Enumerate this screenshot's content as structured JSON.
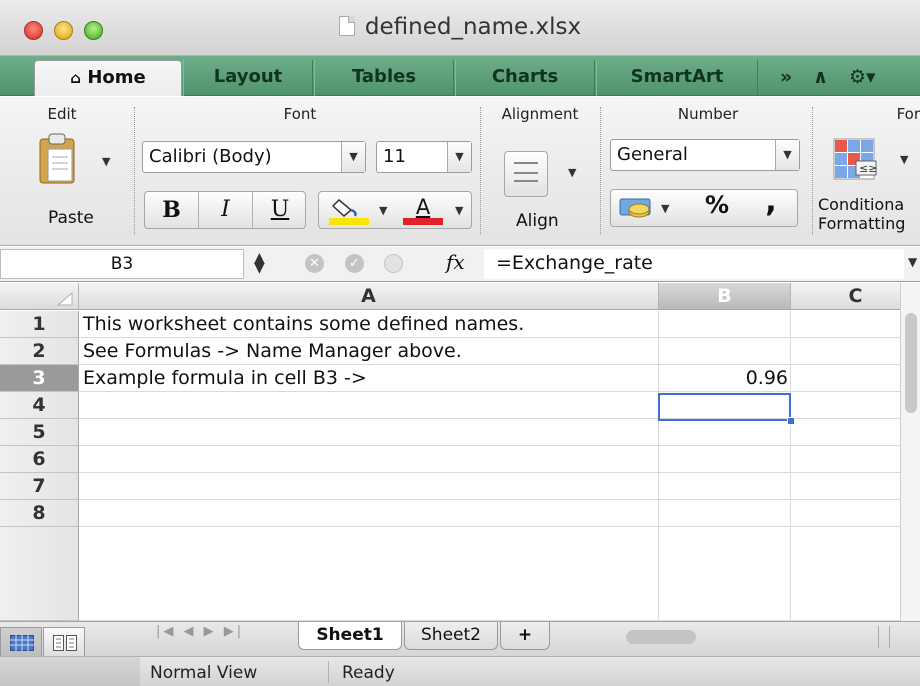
{
  "window": {
    "title": "defined_name.xlsx"
  },
  "tabs": [
    {
      "label": "Home",
      "icon": "house-icon",
      "active": true
    },
    {
      "label": "Layout"
    },
    {
      "label": "Tables"
    },
    {
      "label": "Charts"
    },
    {
      "label": "SmartArt"
    }
  ],
  "tabs_overflow": "»",
  "ribbon": {
    "groups": {
      "edit": "Edit",
      "font": "Font",
      "alignment": "Alignment",
      "number": "Number",
      "format": "For"
    },
    "paste_label": "Paste",
    "font_name": "Calibri (Body)",
    "font_size": "11",
    "bold": "B",
    "italic": "I",
    "underline": "U",
    "font_color_letter": "A",
    "align_label": "Align",
    "number_format": "General",
    "percent": "%",
    "comma": ",",
    "conditional_line1": "Conditiona",
    "conditional_line2": "Formatting",
    "colors": {
      "highlight": "#f7e600",
      "font_color": "#e0232a",
      "tab_bar": "#5a9e77"
    }
  },
  "formula_bar": {
    "name_box": "B3",
    "fx": "fx",
    "formula": "=Exchange_rate"
  },
  "grid": {
    "columns": [
      "A",
      "B",
      "C"
    ],
    "selected_column": "B",
    "rows": [
      {
        "num": "1",
        "a": "This worksheet contains some defined names.",
        "b": ""
      },
      {
        "num": "2",
        "a": "See Formulas -> Name Manager above.",
        "b": ""
      },
      {
        "num": "3",
        "a": "Example formula in cell B3 ->",
        "b": "0.96",
        "selected": true
      },
      {
        "num": "4",
        "a": "",
        "b": ""
      },
      {
        "num": "5",
        "a": "",
        "b": ""
      },
      {
        "num": "6",
        "a": "",
        "b": ""
      },
      {
        "num": "7",
        "a": "",
        "b": ""
      },
      {
        "num": "8",
        "a": "",
        "b": ""
      }
    ]
  },
  "sheets": [
    {
      "label": "Sheet1",
      "active": true
    },
    {
      "label": "Sheet2"
    }
  ],
  "add_sheet": "+",
  "status": {
    "view": "Normal View",
    "state": "Ready"
  }
}
